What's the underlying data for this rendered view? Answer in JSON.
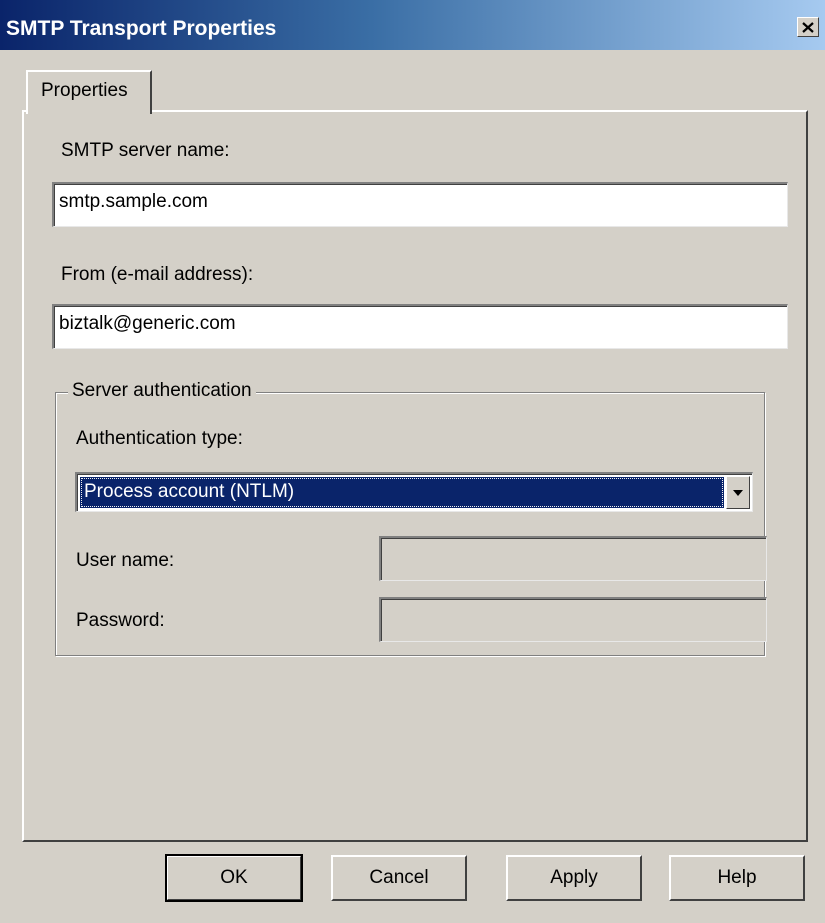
{
  "window": {
    "title": "SMTP Transport Properties",
    "close_icon": "close-icon"
  },
  "tabs": [
    {
      "label": "Properties",
      "active": true
    }
  ],
  "form": {
    "server_name_label": "SMTP server name:",
    "server_name_value": "smtp.sample.com",
    "from_label": "From (e-mail address):",
    "from_value": "biztalk@generic.com"
  },
  "auth_group": {
    "legend": "Server authentication",
    "type_label": "Authentication type:",
    "type_selected": "Process account (NTLM)",
    "username_label": "User name:",
    "username_value": "",
    "password_label": "Password:",
    "password_value": ""
  },
  "buttons": {
    "ok": "OK",
    "cancel": "Cancel",
    "apply": "Apply",
    "help": "Help"
  },
  "colors": {
    "face": "#d4d0c8",
    "titlebar_start": "#0a246a",
    "titlebar_end": "#a6caf0",
    "selection": "#0a246a"
  }
}
